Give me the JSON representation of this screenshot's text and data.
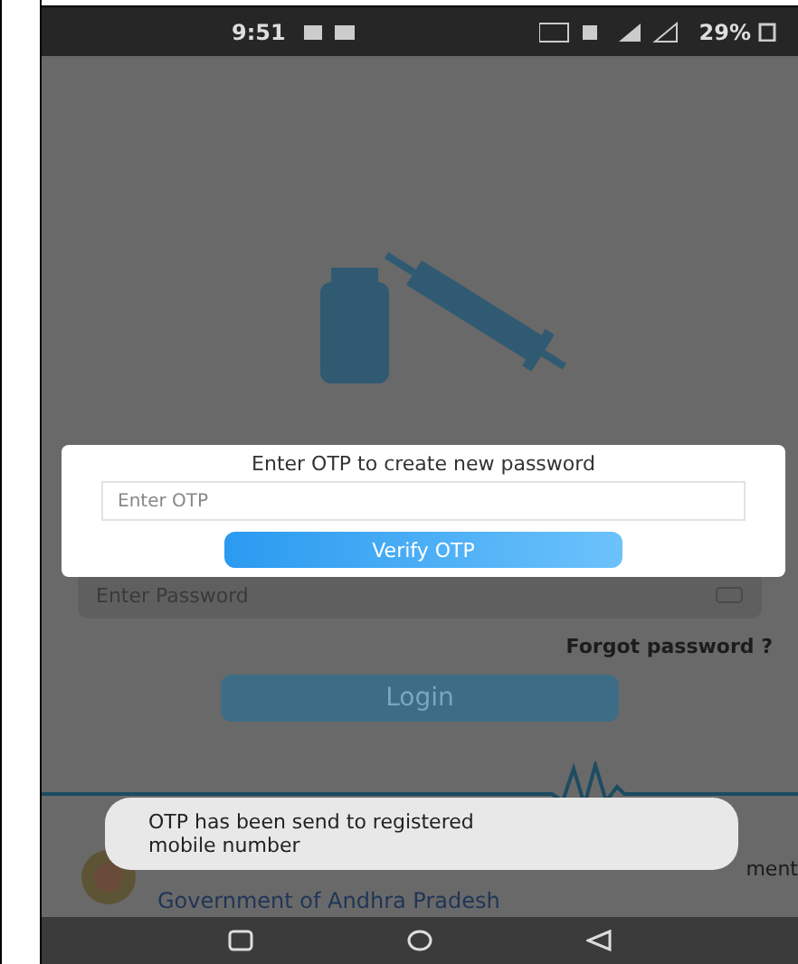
{
  "status_bar": {
    "time": "9:51",
    "battery": "29%"
  },
  "login_form": {
    "password_placeholder": "Enter Password",
    "forgot_link": "Forgot password ?",
    "login_button": "Login"
  },
  "footer": {
    "department": "ment",
    "government": "Government of Andhra Pradesh"
  },
  "otp_dialog": {
    "title": "Enter OTP to create new password",
    "otp_placeholder": "Enter OTP",
    "verify_button": "Verify OTP"
  },
  "toast": {
    "message": "OTP has been send to registered mobile number"
  }
}
